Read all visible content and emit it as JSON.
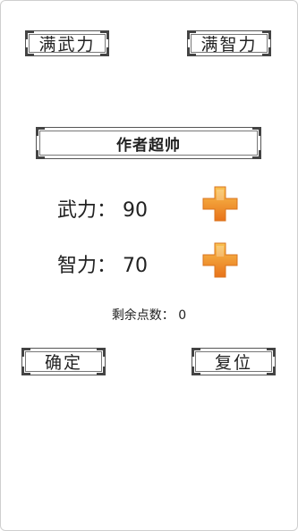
{
  "top_buttons": {
    "max_force": "满武力",
    "max_intelligence": "满智力"
  },
  "title": "作者超帅",
  "stats": {
    "force": {
      "label": "武力：",
      "value": "90"
    },
    "intelligence": {
      "label": "智力：",
      "value": "70"
    }
  },
  "remaining": {
    "label": "剩余点数：",
    "value": "0"
  },
  "bottom_buttons": {
    "confirm": "确定",
    "reset": "复位"
  },
  "colors": {
    "plus_light": "#f7b03a",
    "plus_dark": "#e8771a"
  }
}
